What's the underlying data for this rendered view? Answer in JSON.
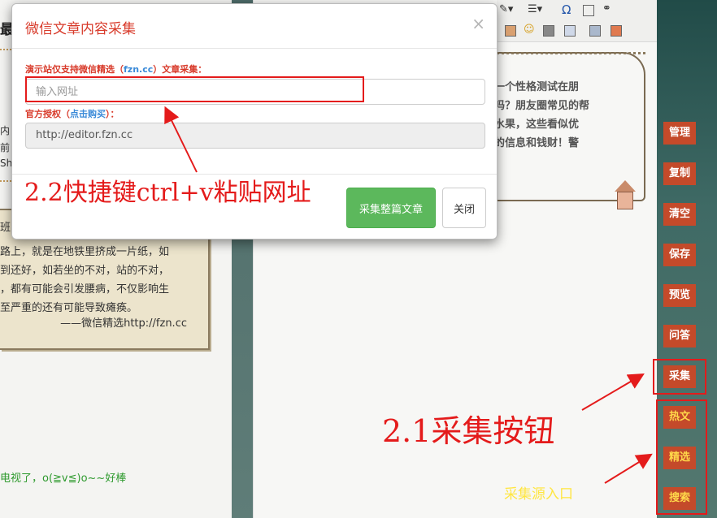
{
  "modal": {
    "title": "微信文章内容采集",
    "close_glyph": "×",
    "label_prefix": "演示站仅支持微信精选（",
    "label_link": "fzn.cc",
    "label_suffix": "）文章采集：",
    "url_placeholder": "输入网址",
    "auth_prefix": "官方授权（",
    "auth_link": "点击购买",
    "auth_suffix": "）：",
    "auth_url": "http://editor.fzn.cc",
    "collect_button": "采集整篇文章",
    "close_button": "关闭"
  },
  "left_article": {
    "title_fragment": "最",
    "snips": [
      "内",
      "前",
      "Sh"
    ],
    "paper_lines": [
      "班",
      "路上，就是在地铁里挤成一片纸，如",
      "到还好，如若坐的不对，站的不对，",
      "，都有可能会引发腰病，不仅影响生",
      "至严重的还有可能导致瘫痪。"
    ],
    "paper_sign": "——微信精选http://fzn.cc",
    "green_line": "电视了，o(≧v≦)o~~好棒"
  },
  "middle_frame": {
    "lines": [
      "一个性格测试在朋",
      "吗？朋友圈常见的帮",
      "水果，这些看似优",
      "的信息和钱财！警"
    ]
  },
  "sidebar": {
    "buttons": [
      "管理",
      "复制",
      "清空",
      "保存",
      "预览",
      "问答",
      "采集"
    ],
    "source_buttons": [
      "热文",
      "精选",
      "搜索"
    ]
  },
  "annotations": {
    "paste_hint": "2.2快捷键ctrl+v粘贴网址",
    "collect_hint": "2.1采集按钮",
    "source_hint": "采集源入口"
  },
  "colors": {
    "accent_red": "#e41b1b",
    "modal_title": "#d83a2a",
    "link_blue": "#3a8ad8",
    "primary_green": "#5cb85c",
    "side_button": "#c44a2a",
    "source_yellow": "#ffd84a"
  },
  "icons": [
    "dropdown-arrow-icon",
    "line-spacing-icon",
    "omega-icon",
    "table-icon",
    "binoculars-icon",
    "image-icon",
    "emoji-icon",
    "film-icon",
    "media-icon",
    "code-icon",
    "template-icon"
  ]
}
